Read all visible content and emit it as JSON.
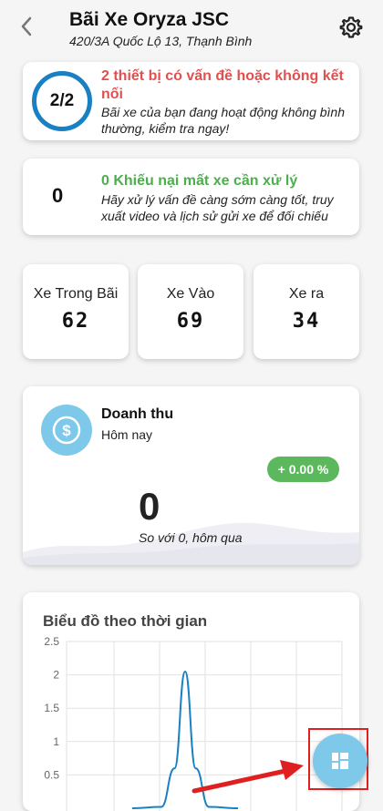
{
  "header": {
    "title": "Bãi Xe Oryza JSC",
    "address": "420/3A Quốc Lộ 13, Thạnh Bình",
    "back_icon": "chevron-left-icon",
    "settings_icon": "gear-icon"
  },
  "device_alert": {
    "ratio": "2/2",
    "title": "2 thiết bị có vấn đề hoặc không kết nối",
    "description": "Bãi xe của bạn đang hoạt động không bình thường, kiểm tra ngay!"
  },
  "claims": {
    "count": "0",
    "title": "0 Khiếu nại mất xe cần xử lý",
    "description": "Hãy xử lý vấn đề càng sớm càng tốt, truy xuất video và lịch sử gửi xe để đối chiếu"
  },
  "stats": [
    {
      "label": "Xe Trong Bãi",
      "value": "62"
    },
    {
      "label": "Xe Vào",
      "value": "69"
    },
    {
      "label": "Xe ra",
      "value": "34"
    }
  ],
  "revenue": {
    "icon": "dollar-coin-icon",
    "title": "Doanh thu",
    "period": "Hôm nay",
    "change": "+ 0.00 %",
    "value": "0",
    "comparison": "So với 0, hôm qua"
  },
  "time_chart": {
    "title": "Biểu đồ theo thời gian"
  },
  "fab": {
    "icon": "dashboard-grid-icon"
  },
  "colors": {
    "alert_red": "#e05050",
    "success_green": "#4cae4c",
    "ring_blue": "#1a80c4",
    "accent_light_blue": "#7ec8ea",
    "highlight_red": "#e02020"
  },
  "chart_data": {
    "type": "line",
    "title": "Biểu đồ theo thời gian",
    "ylim": [
      0,
      2.5
    ],
    "y_ticks": [
      "2.5",
      "2",
      "1.5",
      "1",
      "0.5"
    ],
    "grid": true,
    "series": [
      {
        "points": [
          [
            0,
            0
          ],
          [
            0.55,
            0.02
          ],
          [
            0.8,
            0.6
          ],
          [
            1.0,
            2.05
          ],
          [
            1.2,
            0.6
          ],
          [
            1.45,
            0.02
          ],
          [
            2,
            0
          ]
        ]
      }
    ]
  }
}
